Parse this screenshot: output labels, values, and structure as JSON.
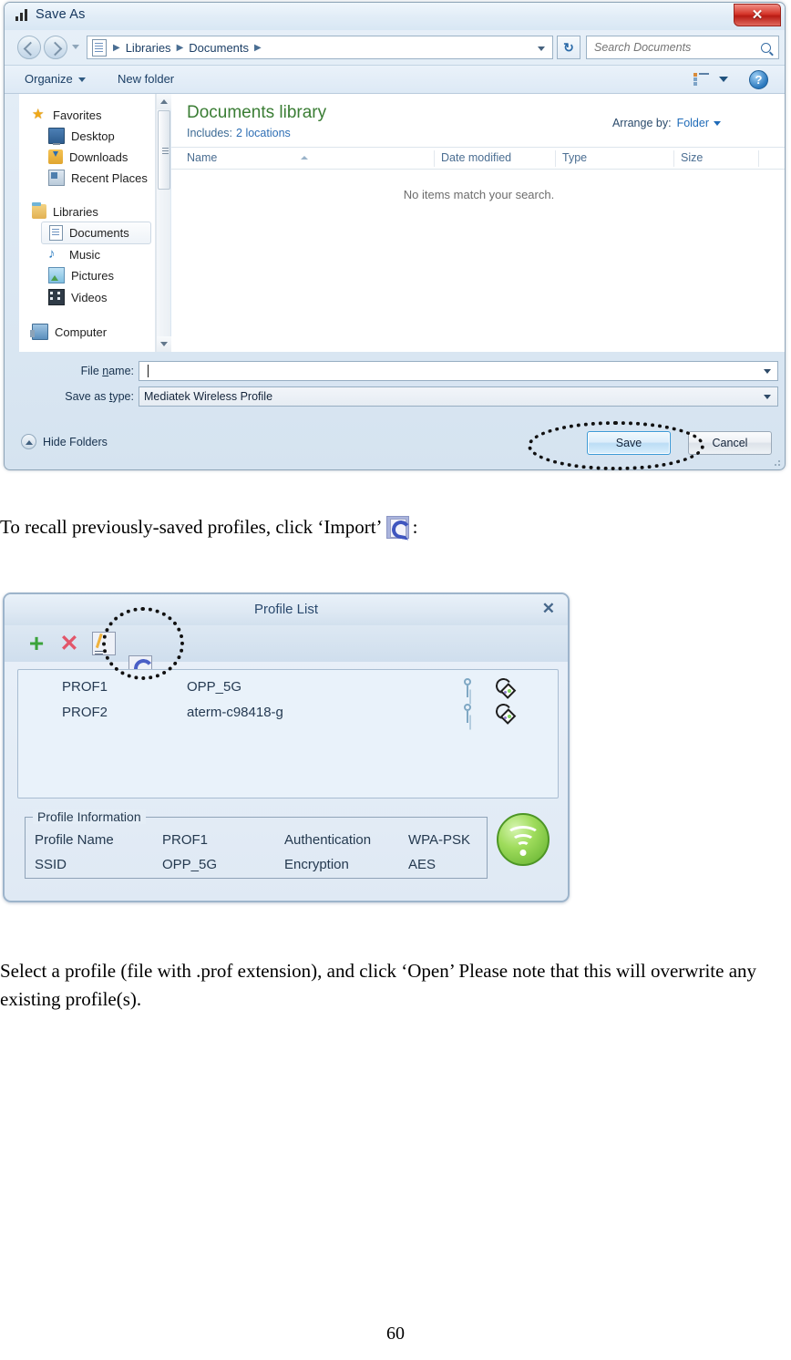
{
  "save_dialog": {
    "title": "Save As",
    "title_icon": "signal-bars-icon",
    "close_label": "✕",
    "nav": {
      "back_title": "Back",
      "forward_title": "Forward",
      "breadcrumb": [
        "Libraries",
        "Documents"
      ],
      "separator": "▶",
      "refresh_label": "↻"
    },
    "search": {
      "placeholder": "Search Documents",
      "value": ""
    },
    "toolbar": {
      "organize": "Organize",
      "new_folder": "New folder",
      "help_label": "?"
    },
    "sidebar": {
      "groups": [
        {
          "label": "Favorites",
          "icon": "star-icon",
          "children": [
            {
              "label": "Desktop",
              "icon": "desktop-icon"
            },
            {
              "label": "Downloads",
              "icon": "downloads-icon"
            },
            {
              "label": "Recent Places",
              "icon": "recent-places-icon"
            }
          ]
        },
        {
          "label": "Libraries",
          "icon": "libraries-icon",
          "children": [
            {
              "label": "Documents",
              "icon": "document-icon",
              "selected": true
            },
            {
              "label": "Music",
              "icon": "music-icon"
            },
            {
              "label": "Pictures",
              "icon": "pictures-icon"
            },
            {
              "label": "Videos",
              "icon": "videos-icon"
            }
          ]
        },
        {
          "label": "Computer",
          "icon": "computer-icon",
          "children": []
        }
      ]
    },
    "file_pane": {
      "library_title": "Documents library",
      "includes_label": "Includes:",
      "includes_value": "2 locations",
      "arrange_label": "Arrange by:",
      "arrange_value": "Folder",
      "columns": [
        "Name",
        "Date modified",
        "Type",
        "Size"
      ],
      "empty_message": "No items match your search."
    },
    "form": {
      "file_name_label": "File name:",
      "file_name_value": "",
      "save_type_label": "Save as type:",
      "save_type_value": "Mediatek Wireless Profile"
    },
    "footer": {
      "hide_folders": "Hide Folders",
      "save_label": "Save",
      "cancel_label": "Cancel"
    }
  },
  "body_text": {
    "paragraph_1_before": "To recall previously-saved profiles, click ‘Import’",
    "paragraph_1_after": ":",
    "paragraph_2": "Select a profile (file with .prof extension), and click ‘Open’ Please note that this will overwrite any existing profile(s)."
  },
  "profile_window": {
    "title": "Profile List",
    "close_label": "✕",
    "toolbar": [
      {
        "name": "add",
        "glyph": "+"
      },
      {
        "name": "delete",
        "glyph": "✕"
      },
      {
        "name": "edit",
        "glyph": ""
      },
      {
        "name": "import",
        "glyph": ""
      },
      {
        "name": "export",
        "glyph": ""
      },
      {
        "name": "refresh",
        "glyph": ""
      }
    ],
    "profiles": [
      {
        "name": "PROF1",
        "ssid": "OPP_5G"
      },
      {
        "name": "PROF2",
        "ssid": "aterm-c98418-g"
      }
    ],
    "info": {
      "legend": "Profile Information",
      "profile_name_label": "Profile Name",
      "profile_name_value": "PROF1",
      "auth_label": "Authentication",
      "auth_value": "WPA-PSK",
      "ssid_label": "SSID",
      "ssid_value": "OPP_5G",
      "encryption_label": "Encryption",
      "encryption_value": "AES"
    }
  },
  "page_number": "60"
}
